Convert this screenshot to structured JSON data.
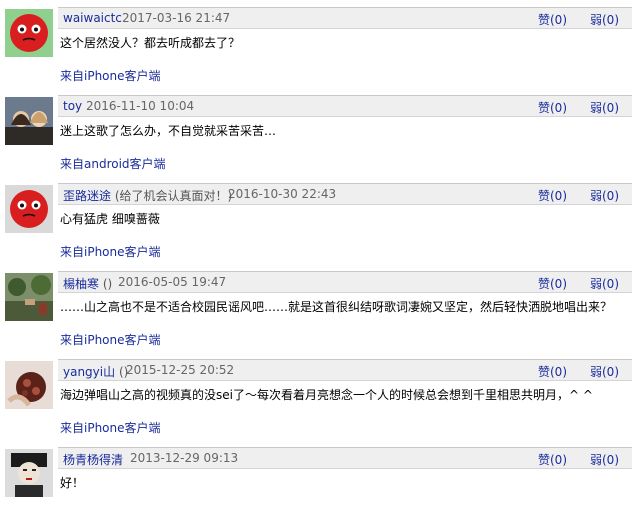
{
  "comments": [
    {
      "user": "waiwaictc",
      "extra": "",
      "time": "2017-03-16 21:47",
      "up": "赞(0)",
      "down": "弱(0)",
      "content": "这个居然没人？都去听成都去了？",
      "source": "来自iPhone客户端",
      "avatar": "red-face-avatar"
    },
    {
      "user": "toy",
      "extra": "",
      "time": "2016-11-10 10:04",
      "up": "赞(0)",
      "down": "弱(0)",
      "content": "迷上这歌了怎么办，不自觉就采苦采苦…",
      "source": "来自android客户端",
      "avatar": "photo-avatar"
    },
    {
      "user": "歪路迷途",
      "extra": "(给了机会认真面对！)",
      "time": "2016-10-30 22:43",
      "up": "赞(0)",
      "down": "弱(0)",
      "content": "心有猛虎 细嗅蔷薇",
      "source": "来自iPhone客户端",
      "avatar": "red-face-avatar"
    },
    {
      "user": "楊柚寒",
      "extra": "()",
      "time": "2016-05-05 19:47",
      "up": "赞(0)",
      "down": "弱(0)",
      "content": "……山之高也不是不适合校园民谣风吧……就是这首很纠结呀歌词凄婉又坚定，然后轻快洒脱地唱出来？",
      "source": "来自iPhone客户端",
      "avatar": "photo-avatar"
    },
    {
      "user": "yangyi山",
      "extra": "()",
      "time": "2015-12-25 20:52",
      "up": "赞(0)",
      "down": "弱(0)",
      "content": "海边弹唱山之高的视频真的没sei了～每次看着月亮想念一个人的时候总会想到千里相思共明月，^ ^",
      "source": "来自iPhone客户端",
      "avatar": "photo-avatar"
    },
    {
      "user": "杨青杨得清",
      "extra": "",
      "time": "2013-12-29 09:13",
      "up": "赞(0)",
      "down": "弱(0)",
      "content": "好！",
      "source": "",
      "avatar": "photo-avatar"
    }
  ],
  "colors": {
    "link": "#1a2c9a",
    "bar": "#efefef",
    "avatar_red": "#d81e1e"
  }
}
